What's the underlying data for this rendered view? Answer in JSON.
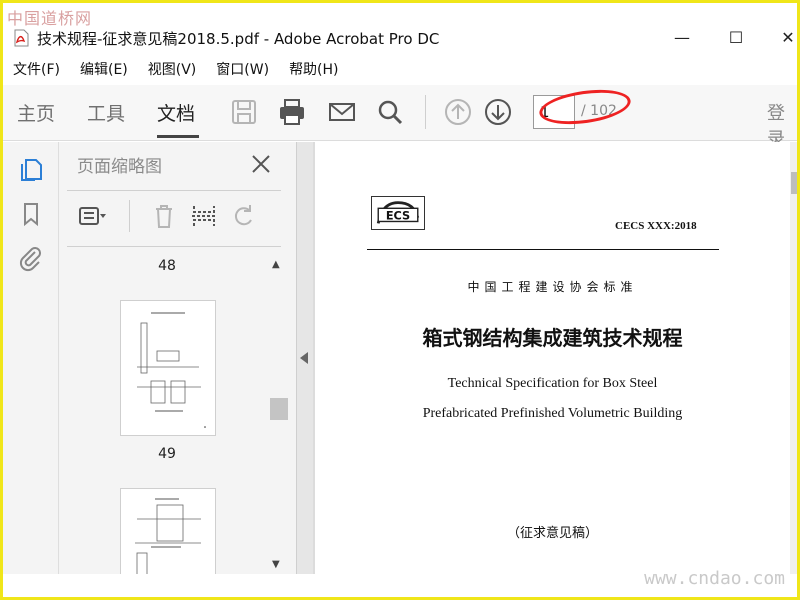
{
  "watermarks": {
    "top": "中国道桥网",
    "bottom": "www.cndao.com"
  },
  "window": {
    "title": "技术规程-征求意见稿2018.5.pdf - Adobe Acrobat Pro DC",
    "minimize": "—",
    "maximize": "☐",
    "close": "✕"
  },
  "menu": [
    "文件(F)",
    "编辑(E)",
    "视图(V)",
    "窗口(W)",
    "帮助(H)"
  ],
  "toolbar": {
    "tabs": [
      "主页",
      "工具",
      "文档"
    ],
    "active_tab": "文档",
    "current_page": "1",
    "total_pages": "/ 102",
    "login": "登录"
  },
  "panel": {
    "title": "页面缩略图",
    "thumbnails": [
      {
        "label": "48"
      },
      {
        "label": "49"
      }
    ]
  },
  "document": {
    "logo_text": "ECS",
    "code": "CECS XXX:2018",
    "association": "中国工程建设协会标准",
    "title_cn": "箱式钢结构集成建筑技术规程",
    "title_en_line1": "Technical Specification for Box Steel",
    "title_en_line2": "Prefabricated Prefinished Volumetric Building",
    "draft_note": "（征求意见稿）"
  },
  "colors": {
    "frame": "#f0e619",
    "highlight_circle": "#e22222",
    "accent_blue": "#2c7fd6"
  }
}
